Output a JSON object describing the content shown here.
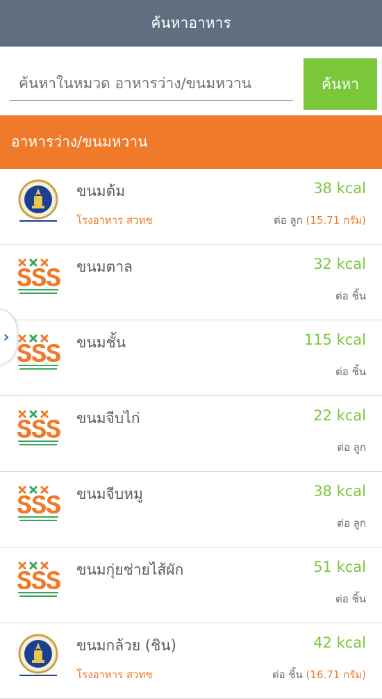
{
  "header": {
    "title": "ค้นหาอาหาร"
  },
  "search": {
    "placeholder": "ค้นหาในหมวด อาหารว่าง/ขนมหวาน",
    "button_label": "ค้นหา"
  },
  "category": {
    "title": "อาหารว่าง/ขนมหวาน"
  },
  "colors": {
    "header_bg": "#5f6f80",
    "accent_green": "#7ac73a",
    "accent_orange": "#ef7a2a"
  },
  "drawer": {
    "icon": "chevron-right-icon",
    "glyph": "›"
  },
  "items": [
    {
      "logo": "mahidol-nutrition-logo",
      "name": "ขนมต้ม",
      "kcal": "38 kcal",
      "source": "โรงอาหาร สวทช",
      "unit": "ต่อ ลูก",
      "weight": "(15.71 กรัม)"
    },
    {
      "logo": "thaihealth-logo",
      "name": "ขนมตาล",
      "kcal": "32 kcal",
      "source": "",
      "unit": "ต่อ ชิ้น",
      "weight": ""
    },
    {
      "logo": "thaihealth-logo",
      "name": "ขนมชั้น",
      "kcal": "115 kcal",
      "source": "",
      "unit": "ต่อ ชิ้น",
      "weight": ""
    },
    {
      "logo": "thaihealth-logo",
      "name": "ขนมจีบไก่",
      "kcal": "22 kcal",
      "source": "",
      "unit": "ต่อ ลูก",
      "weight": ""
    },
    {
      "logo": "thaihealth-logo",
      "name": "ขนมจีบหมู",
      "kcal": "38 kcal",
      "source": "",
      "unit": "ต่อ ลูก",
      "weight": ""
    },
    {
      "logo": "thaihealth-logo",
      "name": "ขนมกุ่ยช่ายไส้ผัก",
      "kcal": "51 kcal",
      "source": "",
      "unit": "ต่อ ชิ้น",
      "weight": ""
    },
    {
      "logo": "mahidol-nutrition-logo",
      "name": "ขนมกล้วย (ชิน)",
      "kcal": "42 kcal",
      "source": "โรงอาหาร สวทช",
      "unit": "ต่อ ชิ้น",
      "weight": "(16.71 กรัม)"
    }
  ]
}
